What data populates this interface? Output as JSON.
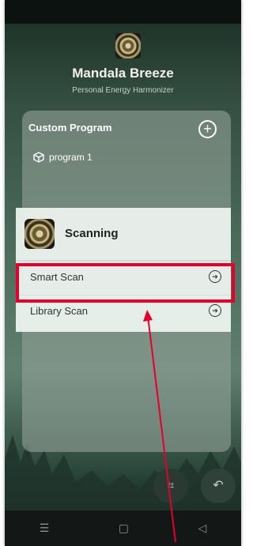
{
  "app": {
    "title": "Mandala Breeze",
    "subtitle": "Personal Energy Harmonizer"
  },
  "custom_program": {
    "header": "Custom Program",
    "add_icon": "plus-circle-icon",
    "programs": [
      {
        "label": "program 1",
        "icon": "cube-icon"
      }
    ]
  },
  "scan_modal": {
    "title": "Scanning",
    "options": [
      {
        "label": "Smart Scan",
        "icon": "arrow-right-circle-icon"
      },
      {
        "label": "Library Scan",
        "icon": "arrow-right-circle-icon"
      }
    ]
  },
  "fab": {
    "scan_icon": "scan-icon",
    "back_icon": "undo-arrow-icon"
  },
  "nav": {
    "menu_glyph": "☰",
    "home_glyph": "▢",
    "back_glyph": "◁"
  },
  "annotation": {
    "highlight_color": "#e4002b",
    "arrow_color": "#e4002b",
    "highlighted_option": "Smart Scan"
  }
}
